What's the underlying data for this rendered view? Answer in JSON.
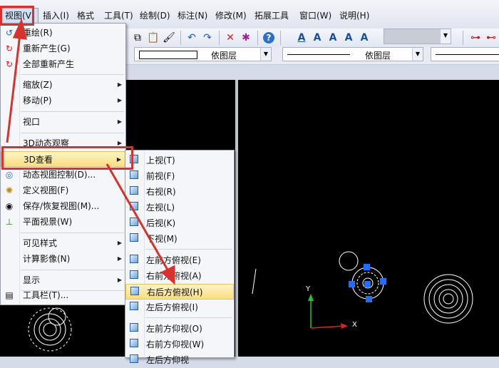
{
  "menubar": {
    "items": [
      "视图(V)",
      "插入(I)",
      "格式",
      "工具(T)",
      "绘制(D)",
      "标注(N)",
      "修改(M)",
      "拓展工具",
      "窗口(W)",
      "说明(H)"
    ]
  },
  "propbar": {
    "layer_value": "依图层",
    "linetype_value": "依图层"
  },
  "view_menu": {
    "items": [
      {
        "label": "重绘(R)",
        "icon": "redraw-icon"
      },
      {
        "label": "重新产生(G)",
        "icon": "regen-icon"
      },
      {
        "label": "全部重新产生",
        "icon": "regen-all-icon"
      },
      {
        "label": "缩放(Z)",
        "submenu": true
      },
      {
        "label": "移动(P)",
        "submenu": true
      },
      {
        "label": "视口",
        "submenu": true
      },
      {
        "label": "3D动态观察",
        "submenu": true
      },
      {
        "label": "3D查看",
        "submenu": true,
        "highlighted": true
      },
      {
        "label": "动态视图控制(D)...",
        "icon": "dynamic-view-icon"
      },
      {
        "label": "定义视图(F)",
        "icon": "define-view-icon"
      },
      {
        "label": "保存/恢复视图(M)...",
        "icon": "save-view-icon"
      },
      {
        "label": "平面视景(W)",
        "icon": "plan-view-icon"
      },
      {
        "label": "可见样式",
        "submenu": true
      },
      {
        "label": "计算影像(N)",
        "submenu": true
      },
      {
        "label": "显示",
        "submenu": true
      },
      {
        "label": "工具栏(T)...",
        "icon": "toolbar-icon"
      }
    ]
  },
  "view3d_submenu": {
    "items": [
      {
        "label": "上视(T)"
      },
      {
        "label": "前视(F)"
      },
      {
        "label": "右视(R)"
      },
      {
        "label": "左视(L)"
      },
      {
        "label": "后视(K)"
      },
      {
        "label": "下视(M)"
      },
      {
        "label": "左前方俯视(E)"
      },
      {
        "label": "右前方俯视(A)"
      },
      {
        "label": "右后方俯视(H)",
        "highlighted": true
      },
      {
        "label": "左后方俯视(I)"
      },
      {
        "label": "左前方仰视(O)"
      },
      {
        "label": "右前方仰视(W)"
      },
      {
        "label": "左后方仰视"
      }
    ]
  },
  "ucs": {
    "y_label": "Y",
    "x_label": "X"
  },
  "colors": {
    "highlight": "#fbde7e",
    "annotation_red": "#d8322e",
    "ucs_green": "#1ec81e",
    "ucs_red": "#e02020",
    "grip_blue": "#1e6fff"
  }
}
